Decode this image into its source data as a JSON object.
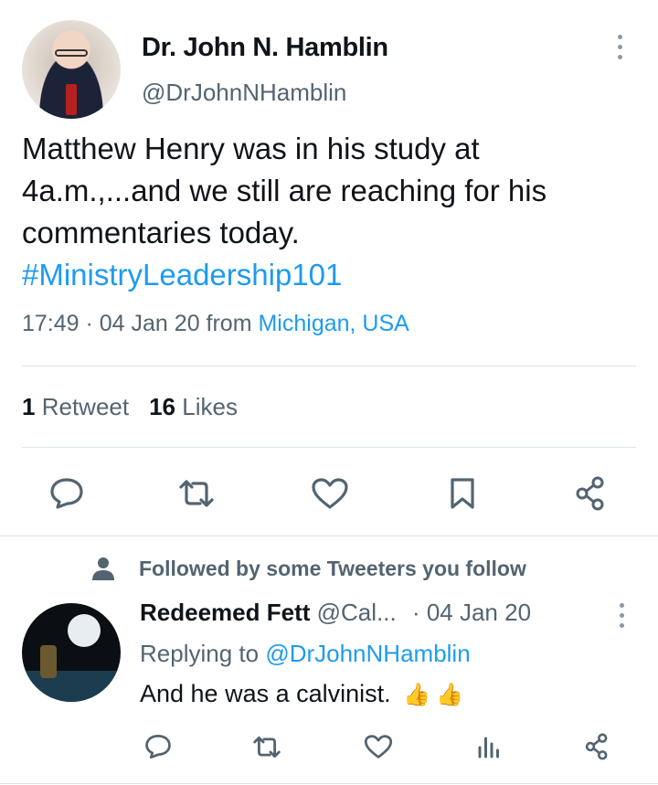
{
  "tweet": {
    "author_name": "Dr. John N. Hamblin",
    "author_handle": "@DrJohnNHamblin",
    "text_line1": "Matthew Henry was in his study at",
    "text_line2": "4a.m.,...and we still are reaching for his",
    "text_line3": "commentaries today.",
    "hashtag": "#MinistryLeadership101",
    "time": "17:49 · 04 Jan 20 from ",
    "location": "Michigan, USA",
    "retweet_count": "1",
    "retweet_label": "Retweet",
    "like_count": "16",
    "like_label": "Likes"
  },
  "follow_note": "Followed by some Tweeters you follow",
  "reply": {
    "name": "Redeemed Fett",
    "handle": "@Cal...",
    "date": "· 04 Jan 20",
    "replying_prefix": "Replying to ",
    "replying_to": "@DrJohnNHamblin",
    "text": "And he was a calvinist.",
    "emoji": "👍",
    "emoji2": "👍"
  },
  "icons": {
    "action_color": "#536471",
    "accent": "#1d9bf0"
  }
}
